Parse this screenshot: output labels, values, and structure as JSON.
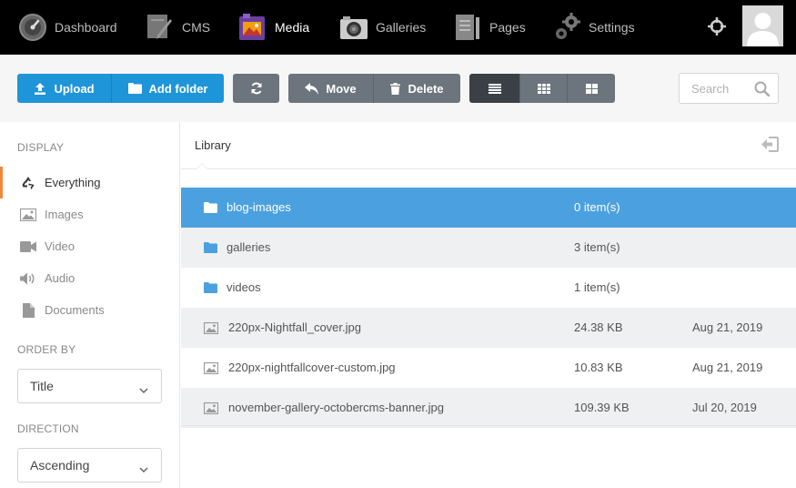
{
  "nav": {
    "items": [
      {
        "label": "Dashboard",
        "icon": "dashboard-icon"
      },
      {
        "label": "CMS",
        "icon": "cms-icon"
      },
      {
        "label": "Media",
        "icon": "media-icon"
      },
      {
        "label": "Galleries",
        "icon": "camera-icon"
      },
      {
        "label": "Pages",
        "icon": "pages-icon"
      },
      {
        "label": "Settings",
        "icon": "gears-icon"
      }
    ],
    "active": "Media"
  },
  "toolbar": {
    "upload_label": "Upload",
    "add_folder_label": "Add folder",
    "move_label": "Move",
    "delete_label": "Delete",
    "search_placeholder": "Search"
  },
  "sidebar": {
    "display_label": "DISPLAY",
    "filters": [
      {
        "label": "Everything",
        "icon": "recycle-icon"
      },
      {
        "label": "Images",
        "icon": "image-icon"
      },
      {
        "label": "Video",
        "icon": "video-icon"
      },
      {
        "label": "Audio",
        "icon": "audio-icon"
      },
      {
        "label": "Documents",
        "icon": "document-icon"
      }
    ],
    "order_by_label": "ORDER BY",
    "order_by_value": "Title",
    "direction_label": "DIRECTION",
    "direction_value": "Ascending"
  },
  "library": {
    "title": "Library",
    "items": [
      {
        "name": "blog-images",
        "size": "0 item(s)",
        "date": "",
        "type": "folder"
      },
      {
        "name": "galleries",
        "size": "3 item(s)",
        "date": "",
        "type": "folder"
      },
      {
        "name": "videos",
        "size": "1 item(s)",
        "date": "",
        "type": "folder"
      },
      {
        "name": "220px-Nightfall_cover.jpg",
        "size": "24.38 KB",
        "date": "Aug 21, 2019",
        "type": "image"
      },
      {
        "name": "220px-nightfallcover-custom.jpg",
        "size": "10.83 KB",
        "date": "Aug 21, 2019",
        "type": "image"
      },
      {
        "name": "november-gallery-octobercms-banner.jpg",
        "size": "109.39 KB",
        "date": "Jul 20, 2019",
        "type": "image"
      }
    ]
  },
  "colors": {
    "accent_blue": "#1e95d9",
    "selected_row": "#4ba1e0",
    "active_filter_border": "#f0883a",
    "topbar": "#000000"
  }
}
